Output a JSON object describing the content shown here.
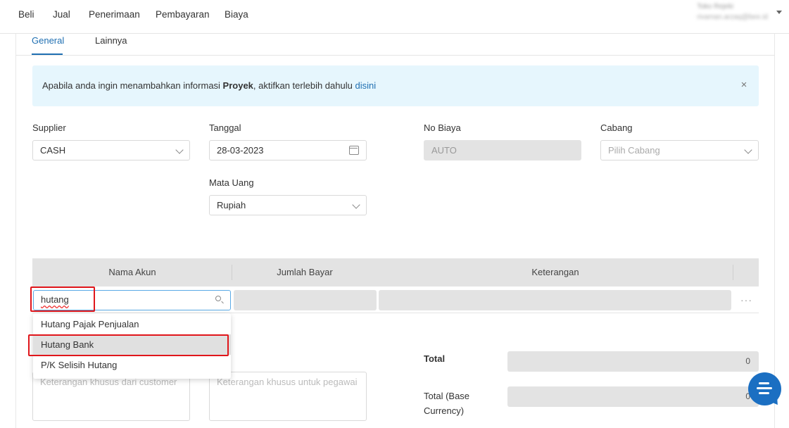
{
  "nav": {
    "items": [
      "Beli",
      "Jual",
      "Penerimaan",
      "Pembayaran",
      "Biaya"
    ],
    "user_name": "Toko Rejeki",
    "user_email": "rivaman.arzaq@bee.id"
  },
  "tabs": [
    "General",
    "Lainnya"
  ],
  "alert": {
    "text_before": "Apabila anda ingin menambahkan informasi ",
    "bold": "Proyek",
    "text_after": ", aktifkan terlebih dahulu ",
    "link": "disini",
    "close": "×"
  },
  "form": {
    "supplier": {
      "label": "Supplier",
      "value": "CASH"
    },
    "tanggal": {
      "label": "Tanggal",
      "value": "28-03-2023"
    },
    "no_biaya": {
      "label": "No Biaya",
      "value": "AUTO"
    },
    "cabang": {
      "label": "Cabang",
      "placeholder": "Pilih Cabang"
    },
    "mata_uang": {
      "label": "Mata Uang",
      "value": "Rupiah"
    }
  },
  "table": {
    "headers": [
      "Nama Akun",
      "Jumlah Bayar",
      "Keterangan"
    ],
    "search_value": "hutang",
    "more": "···"
  },
  "dropdown": {
    "options": [
      "Hutang Pajak Penjualan",
      "Hutang Bank",
      "P/K Selisih Hutang"
    ],
    "highlighted_index": 1
  },
  "notes": {
    "customer_placeholder": "Keterangan khusus dari customer",
    "employee_placeholder": "Keterangan khusus untuk pegawai"
  },
  "totals": {
    "total_label": "Total",
    "total_value": "0",
    "base_label_line1": "Total (Base",
    "base_label_line2": "Currency)",
    "base_value": "0"
  },
  "colors": {
    "accent": "#1f6fb2",
    "alert_bg": "#e6f6fd",
    "highlight_red": "#e0161b",
    "chat": "#1b6fc2"
  }
}
